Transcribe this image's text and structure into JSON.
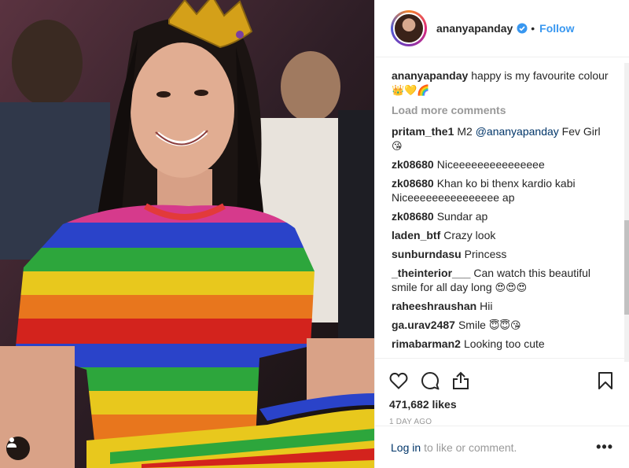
{
  "header": {
    "username": "ananyapanday",
    "separator": "•",
    "follow_label": "Follow"
  },
  "caption": {
    "username": "ananyapanday",
    "text": "happy is my favourite colour",
    "emojis": "👑💛🌈"
  },
  "load_more_label": "Load more comments",
  "comments": [
    {
      "user": "pritam_the1",
      "pre": "M2",
      "mention": "@ananyapanday",
      "text": "Fev Girl",
      "emoji": "😘"
    },
    {
      "user": "zk08680",
      "text": "Niceeeeeeeeeeeeeee"
    },
    {
      "user": "zk08680",
      "text": "Khan ko bi thenx kardio kabi Niceeeeeeeeeeeeeee ap"
    },
    {
      "user": "zk08680",
      "text": "Sundar ap"
    },
    {
      "user": "laden_btf",
      "text": "Crazy look"
    },
    {
      "user": "sunburndasu",
      "text": "Princess"
    },
    {
      "user": "_theinterior___",
      "text": "Can watch this beautiful smile for all day long",
      "emoji": "😍😍😍"
    },
    {
      "user": "raheeshraushan",
      "text": "Hii"
    },
    {
      "user": "ga.urav2487",
      "text": "Smile",
      "emoji": "😇😇😘"
    },
    {
      "user": "rimabarman2",
      "text": "Looking too cute"
    }
  ],
  "actions": {
    "like_icon": "heart-icon",
    "comment_icon": "comment-bubble-icon",
    "share_icon": "share-icon",
    "save_icon": "bookmark-icon"
  },
  "likes_text": "471,682 likes",
  "time_text": "1 DAY AGO",
  "login": {
    "link_label": "Log in",
    "rest_text": "to like or comment.",
    "more_label": "•••"
  },
  "colors": {
    "link_blue": "#3897f0",
    "mention_blue": "#003569",
    "muted_gray": "#999999",
    "text_dark": "#262626"
  }
}
